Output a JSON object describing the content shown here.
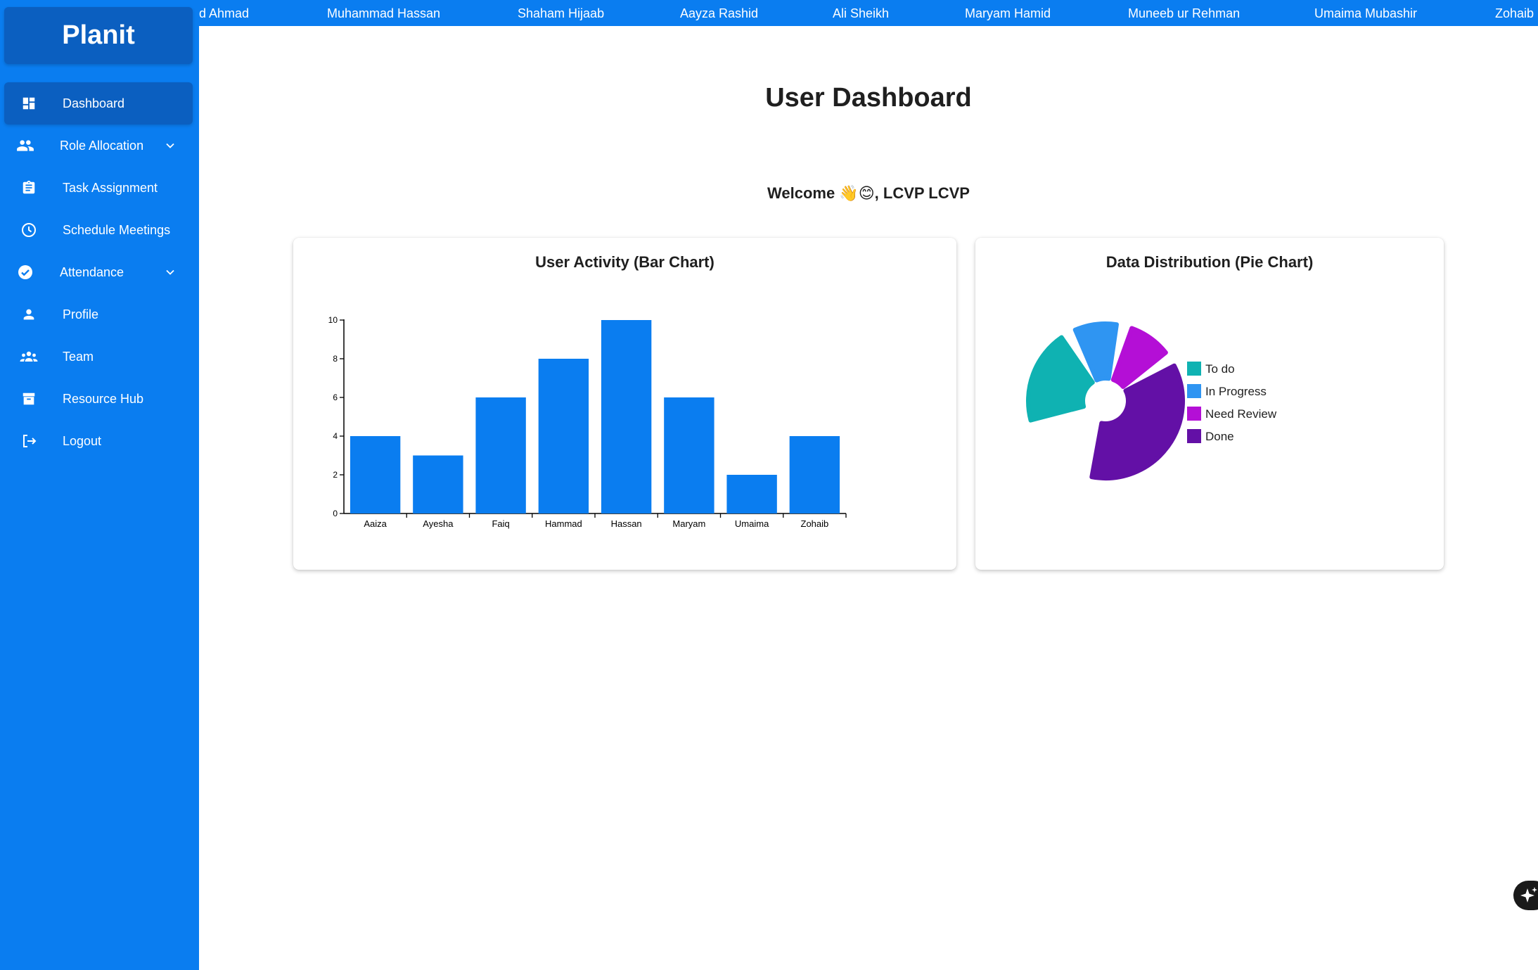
{
  "app": {
    "logo": "Planit"
  },
  "sidebar": {
    "items": [
      {
        "label": "Dashboard",
        "icon": "dashboard-icon",
        "active": true
      },
      {
        "label": "Role Allocation",
        "icon": "people-icon",
        "expandable": true
      },
      {
        "label": "Task Assignment",
        "icon": "clipboard-icon"
      },
      {
        "label": "Schedule Meetings",
        "icon": "clock-icon"
      },
      {
        "label": "Attendance",
        "icon": "check-circle-icon",
        "expandable": true
      },
      {
        "label": "Profile",
        "icon": "person-icon"
      },
      {
        "label": "Team",
        "icon": "groups-icon"
      },
      {
        "label": "Resource Hub",
        "icon": "archive-icon"
      },
      {
        "label": "Logout",
        "icon": "logout-icon"
      }
    ]
  },
  "ticker": {
    "names": [
      "d Ahmad",
      "Muhammad Hassan",
      "Shaham Hijaab",
      "Aayza Rashid",
      "Ali Sheikh",
      "Maryam Hamid",
      "Muneeb ur Rehman",
      "Umaima Mubashir",
      "Zohaib"
    ]
  },
  "main": {
    "title": "User Dashboard",
    "welcome": "Welcome 👋😊, LCVP LCVP"
  },
  "colors": {
    "sidebar": "#0a7df0",
    "sidebar_active": "#0b5fc0",
    "bar": "#0a7df0"
  },
  "chart_data": [
    {
      "type": "bar",
      "title": "User Activity (Bar Chart)",
      "categories": [
        "Aaiza",
        "Ayesha",
        "Faiq",
        "Hammad",
        "Hassan",
        "Maryam",
        "Umaima",
        "Zohaib"
      ],
      "values": [
        4,
        3,
        6,
        8,
        10,
        6,
        2,
        4
      ],
      "yticks": [
        0,
        2,
        4,
        6,
        8,
        10
      ],
      "ylim": [
        0,
        10
      ],
      "grid": false
    },
    {
      "type": "pie",
      "title": "Data Distribution (Pie Chart)",
      "legend_position": "right",
      "slices": [
        {
          "label": "To do",
          "value": 20,
          "color": "#0fb2b2"
        },
        {
          "label": "In Progress",
          "value": 10,
          "color": "#2f95f2"
        },
        {
          "label": "Need Review",
          "value": 10,
          "color": "#b40fd6"
        },
        {
          "label": "Done",
          "value": 35,
          "color": "#6310a6"
        }
      ]
    }
  ]
}
